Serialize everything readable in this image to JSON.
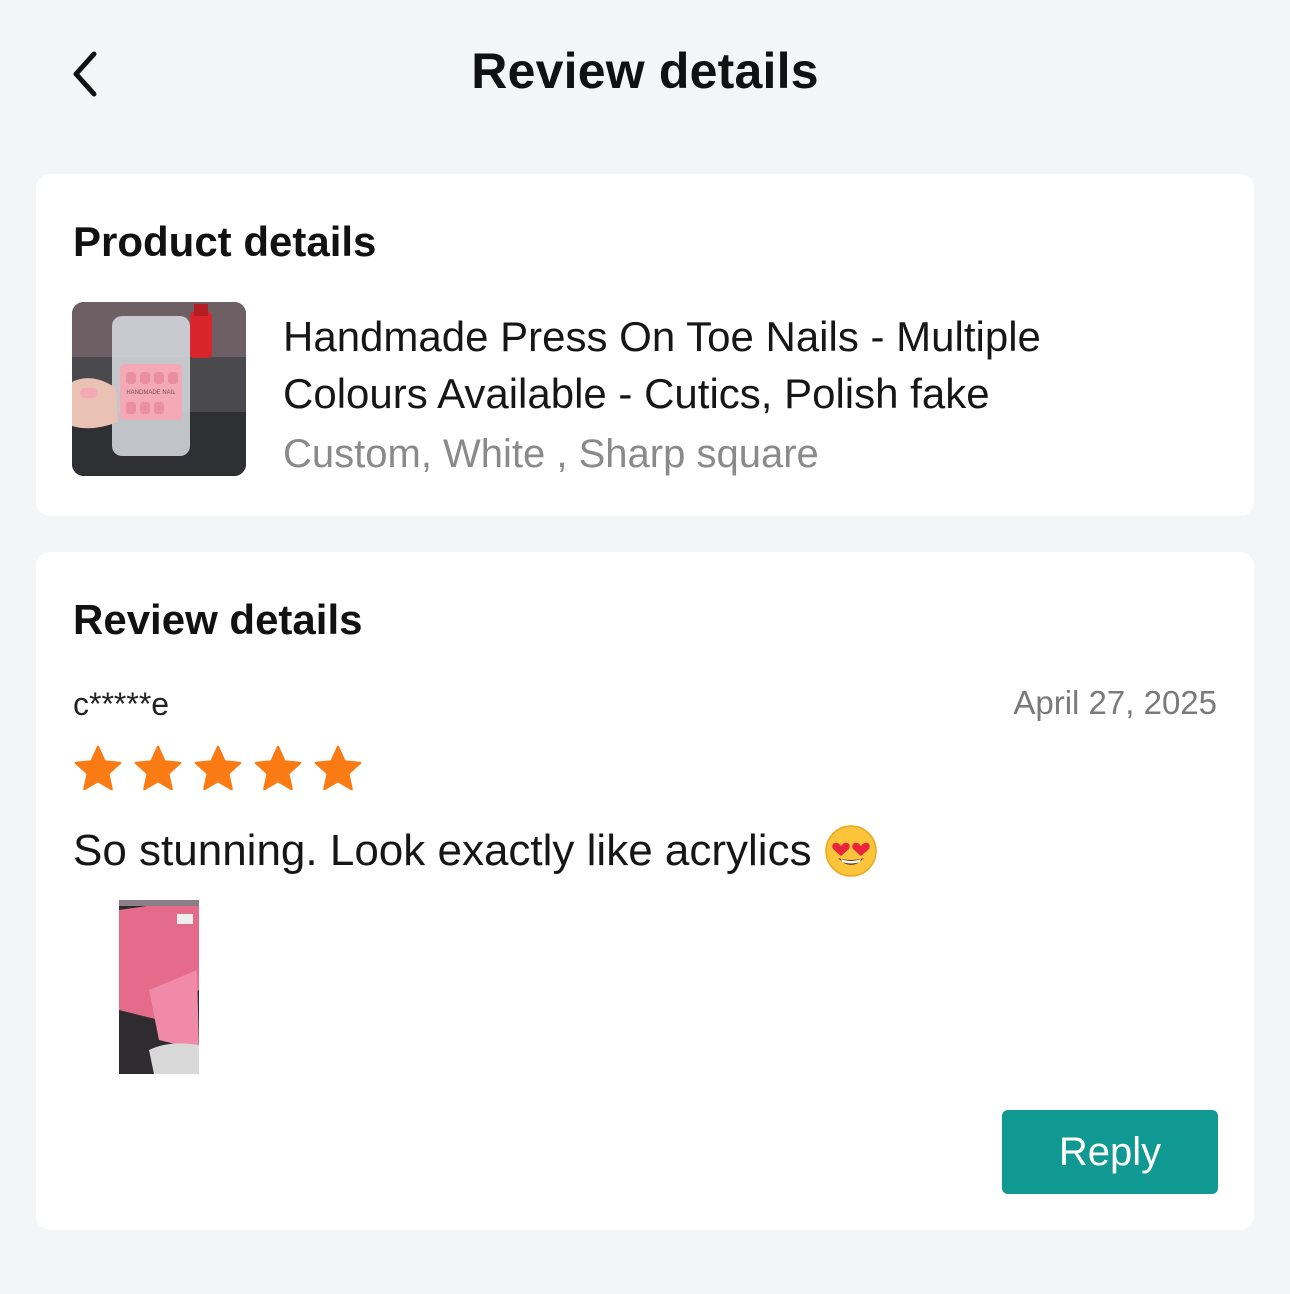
{
  "header": {
    "title": "Review details",
    "back_icon": "chevron-left-icon"
  },
  "product": {
    "section_title": "Product details",
    "name": "Handmade Press On Toe Nails - Multiple Colours Available - Cutics, Polish fake",
    "variant": "Custom, White , Sharp square",
    "image_label": "HANDMADE NAIL"
  },
  "review": {
    "section_title": "Review details",
    "reviewer": "c*****e",
    "date": "April 27, 2025",
    "rating": 5,
    "rating_max": 5,
    "text": "So stunning. Look exactly like acrylics",
    "emoji": "smiling-face-with-heart-eyes",
    "reply_label": "Reply"
  },
  "colors": {
    "star": "#fa7a14",
    "reply_button": "#0f9992",
    "background": "#f4f5f7"
  }
}
